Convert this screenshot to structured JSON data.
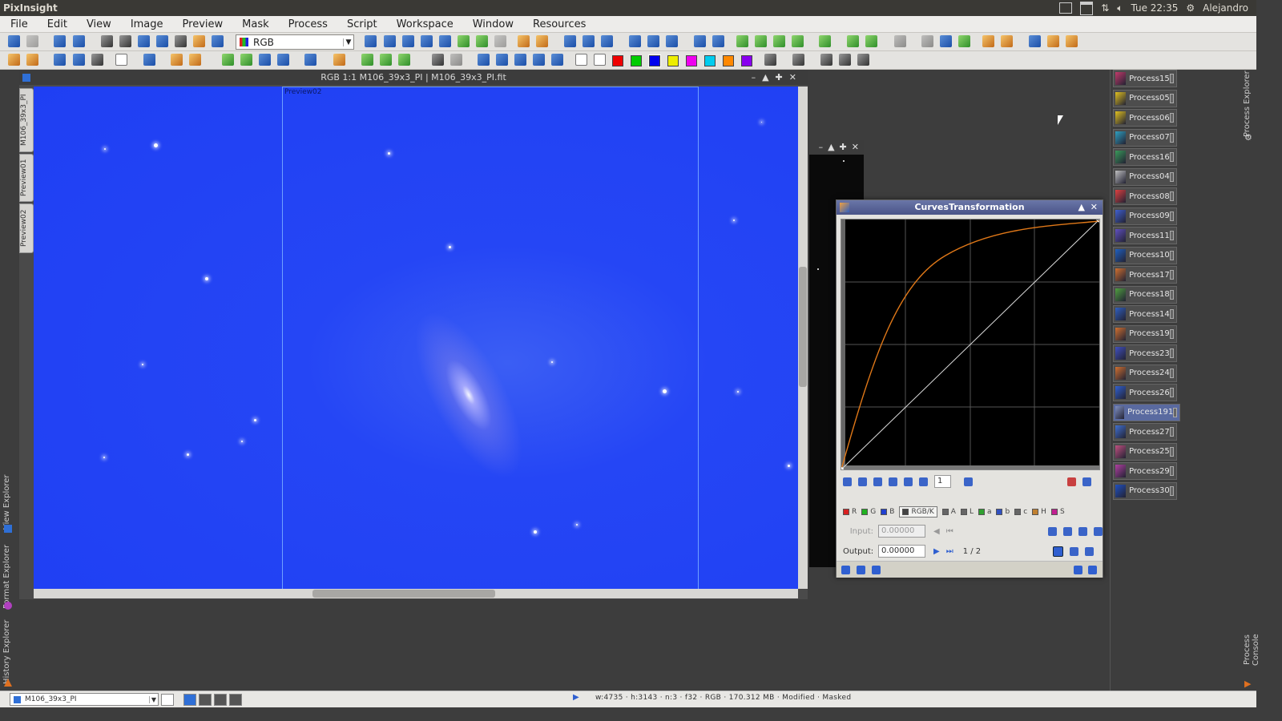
{
  "system": {
    "app_name": "PixInsight",
    "clock": "Tue 22:35",
    "user": "Alejandro",
    "icons": [
      "pencil-icon",
      "mail-icon",
      "network-icon",
      "volume-icon",
      "gear-icon"
    ]
  },
  "menu": [
    "File",
    "Edit",
    "View",
    "Image",
    "Preview",
    "Mask",
    "Process",
    "Script",
    "Workspace",
    "Window",
    "Resources"
  ],
  "toolbar": {
    "color_space": "RGB"
  },
  "image_window": {
    "title": "RGB 1:1 M106_39x3_PI | M106_39x3_PI.fit",
    "preview_label": "Preview02",
    "tabs": [
      "M106_39x3_PI",
      "Preview01",
      "Preview02"
    ]
  },
  "left_dock": {
    "view_explorer": "View Explorer",
    "format_explorer": "Format Explorer",
    "history_explorer": "History Explorer"
  },
  "right_dock": {
    "process_explorer": "Process Explorer",
    "process_console": "Process Console"
  },
  "curves": {
    "title": "CurvesTransformation",
    "zoom_value": "1",
    "channels": [
      {
        "label": "R",
        "color": "#d82020"
      },
      {
        "label": "G",
        "color": "#20b020"
      },
      {
        "label": "B",
        "color": "#2040d0"
      },
      {
        "label": "RGB/K",
        "color": "#444444"
      },
      {
        "label": "A",
        "color": "#666666"
      },
      {
        "label": "L",
        "color": "#666666"
      },
      {
        "label": "a",
        "color": "#30a030"
      },
      {
        "label": "b",
        "color": "#3050c0"
      },
      {
        "label": "c",
        "color": "#666666"
      },
      {
        "label": "H",
        "color": "#c08030"
      },
      {
        "label": "S",
        "color": "#c02090"
      }
    ],
    "selected_channel": "RGB/K",
    "input_label": "Input:",
    "input_value": "0.00000",
    "output_label": "Output:",
    "output_value": "0.00000",
    "point_index": "1 / 2",
    "curve_color": "#e07818"
  },
  "processes": [
    {
      "name": "Process15",
      "icon": "histogram-icon",
      "color": "#c23a6a"
    },
    {
      "name": "Process05",
      "icon": "star-icon",
      "color": "#e0c020"
    },
    {
      "name": "Process06",
      "icon": "star-icon",
      "color": "#e0c020"
    },
    {
      "name": "Process07",
      "icon": "image-icon",
      "color": "#2fa0c0"
    },
    {
      "name": "Process16",
      "icon": "image-icon",
      "color": "#3a9a5a"
    },
    {
      "name": "Process04",
      "icon": "ruler-icon",
      "color": "#c0c0c0"
    },
    {
      "name": "Process08",
      "icon": "color-icon",
      "color": "#e04040"
    },
    {
      "name": "Process09",
      "icon": "curve-icon",
      "color": "#4060d0"
    },
    {
      "name": "Process11",
      "icon": "grid-icon",
      "color": "#6050c0"
    },
    {
      "name": "Process10",
      "icon": "image-icon",
      "color": "#2060c0"
    },
    {
      "name": "Process17",
      "icon": "histogram-icon",
      "color": "#d07030"
    },
    {
      "name": "Process18",
      "icon": "curve-icon",
      "color": "#50a040"
    },
    {
      "name": "Process14",
      "icon": "histogram-icon",
      "color": "#3060c0"
    },
    {
      "name": "Process19",
      "icon": "histogram-icon",
      "color": "#d07030"
    },
    {
      "name": "Process23",
      "icon": "wave-icon",
      "color": "#4050c0"
    },
    {
      "name": "Process24",
      "icon": "histogram-icon",
      "color": "#d07030"
    },
    {
      "name": "Process26",
      "icon": "arrow-icon",
      "color": "#3060d0"
    },
    {
      "name": "Process191",
      "icon": "histogram-icon",
      "color": "#8090c0",
      "selected": true
    },
    {
      "name": "Process27",
      "icon": "bars-icon",
      "color": "#4070d0"
    },
    {
      "name": "Process25",
      "icon": "grid-icon",
      "color": "#c05080"
    },
    {
      "name": "Process29",
      "icon": "curve-icon",
      "color": "#b040a0"
    },
    {
      "name": "Process30",
      "icon": "image-icon",
      "color": "#2050c0"
    }
  ],
  "status": {
    "view_name": "M106_39x3_PI",
    "info": "w:4735 · h:3143 · n:3 · f32 · RGB · 170.312 MB · Modified · Masked"
  }
}
